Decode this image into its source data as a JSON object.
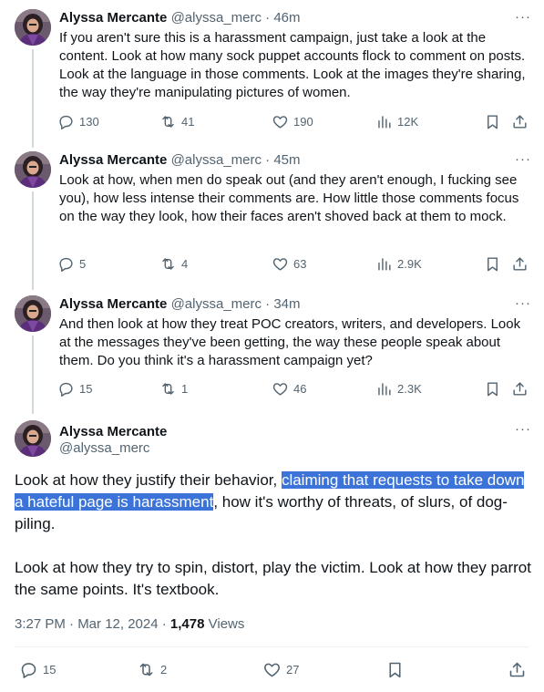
{
  "tweets": [
    {
      "name": "Alyssa Mercante",
      "handle": "@alyssa_merc",
      "time": "· 46m",
      "text": "If you aren't sure this is a harassment campaign, just take a look at the content. Look at how many sock puppet accounts flock to comment on posts. Look at the language in those comments. Look at the images they're sharing, the way they're manipulating pictures of women.",
      "replies": "130",
      "reposts": "41",
      "likes": "190",
      "views": "12K"
    },
    {
      "name": "Alyssa Mercante",
      "handle": "@alyssa_merc",
      "time": "· 45m",
      "text": "Look at how, when men do speak out (and they aren't enough, I fucking see you), how less intense their comments are. How little those comments focus on the way they look, how their faces aren't shoved back at them to mock.",
      "replies": "5",
      "reposts": "4",
      "likes": "63",
      "views": "2.9K"
    },
    {
      "name": "Alyssa Mercante",
      "handle": "@alyssa_merc",
      "time": "· 34m",
      "text": "And then look at how they treat POC creators, writers, and developers. Look at the messages they've been getting, the way these people speak about them. Do you think it's a harassment campaign yet?",
      "replies": "15",
      "reposts": "1",
      "likes": "46",
      "views": "2.3K"
    }
  ],
  "main_tweet": {
    "name": "Alyssa Mercante",
    "handle": "@alyssa_merc",
    "text_before": "Look at how they justify their behavior, ",
    "text_highlight": "claiming that requests to take down a hateful page is harassment",
    "text_after": ", how it's worthy of threats, of slurs, of dog-piling.",
    "text_p2": "Look at how they try to spin, distort, play the victim. Look at how they parrot the same points. It's textbook.",
    "timestamp": "3:27 PM · Mar 12, 2024 · ",
    "views_count": "1,478",
    "views_label": " Views",
    "replies": "15",
    "reposts": "2",
    "likes": "27"
  },
  "more_label": "···",
  "colors": {
    "highlight": "#3b73d8",
    "secondary_text": "#536471",
    "thread_line": "#cfd9de"
  },
  "icons": [
    "reply-icon",
    "repost-icon",
    "like-icon",
    "views-icon",
    "bookmark-icon",
    "share-icon",
    "more-icon"
  ]
}
